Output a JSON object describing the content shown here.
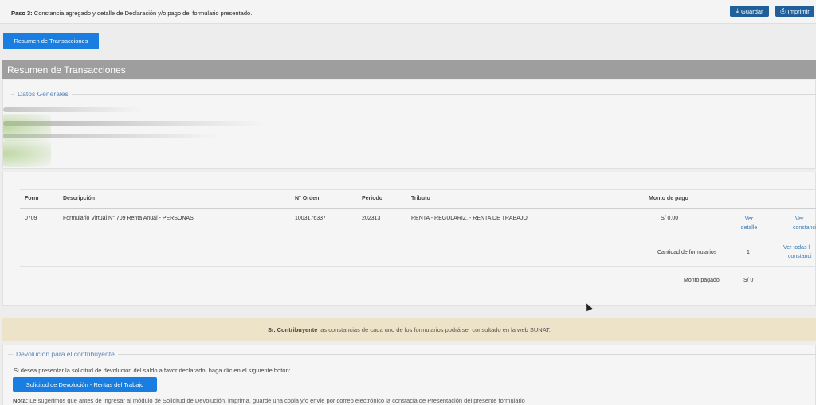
{
  "topbar": {
    "step_label": "Paso 3:",
    "step_text": " Constancia agregado y detalle de Declaración y/o pago del formulario presentado.",
    "save_label": "Guardar",
    "print_label": "Imprimir"
  },
  "resumen_button": "Resumen de Transacciones",
  "section_title": "Resumen de Transacciones",
  "datos_generales": {
    "legend": "Datos Generales"
  },
  "table": {
    "headers": {
      "form": "Form",
      "descripcion": "Descripción",
      "orden": "N° Orden",
      "periodo": "Periodo",
      "tributo": "Tributo",
      "monto": "Monto de pago"
    },
    "row": {
      "form": "0709",
      "descripcion": "Formulario Virtual N° 709 Renta Anual - PERSONAS",
      "orden": "1003176337",
      "periodo": "202313",
      "tributo": "RENTA - REGULARIZ. - RENTA DE TRABAJO",
      "monto": "S/ 0.00",
      "ver_detalle_1": "Ver",
      "ver_detalle_2": "detalle",
      "ver_constancia_1": "Ver",
      "ver_constancia_2": "constanci"
    },
    "cantidad_label": "Cantidad de formularios",
    "cantidad_value": "1",
    "ver_todas_1": "Ver todas l",
    "ver_todas_2": "constanci",
    "monto_pagado_label": "Monto pagado",
    "monto_pagado_value": "S/ 0"
  },
  "notice": {
    "bold": "Sr. Contribuyente",
    "text": " las constancias de cada uno de los formularios podrá ser consultado en la web SUNAT."
  },
  "devolucion": {
    "legend": "Devolución para el contribuyente",
    "text": "Si desea presentar la solicitud de devolución del saldo a favor declarado, haga clic en el siguiente botón:",
    "button": "Solicitud de Devolución - Rentas del Trabajo",
    "nota_label": "Nota:",
    "nota_text": " Le sugerimos que antes de ingresar al módulo de Solicitud de Devolución, imprima, guarde una copia y/o envíe por correo electrónico la constacia de Presentación del presente formulario"
  }
}
